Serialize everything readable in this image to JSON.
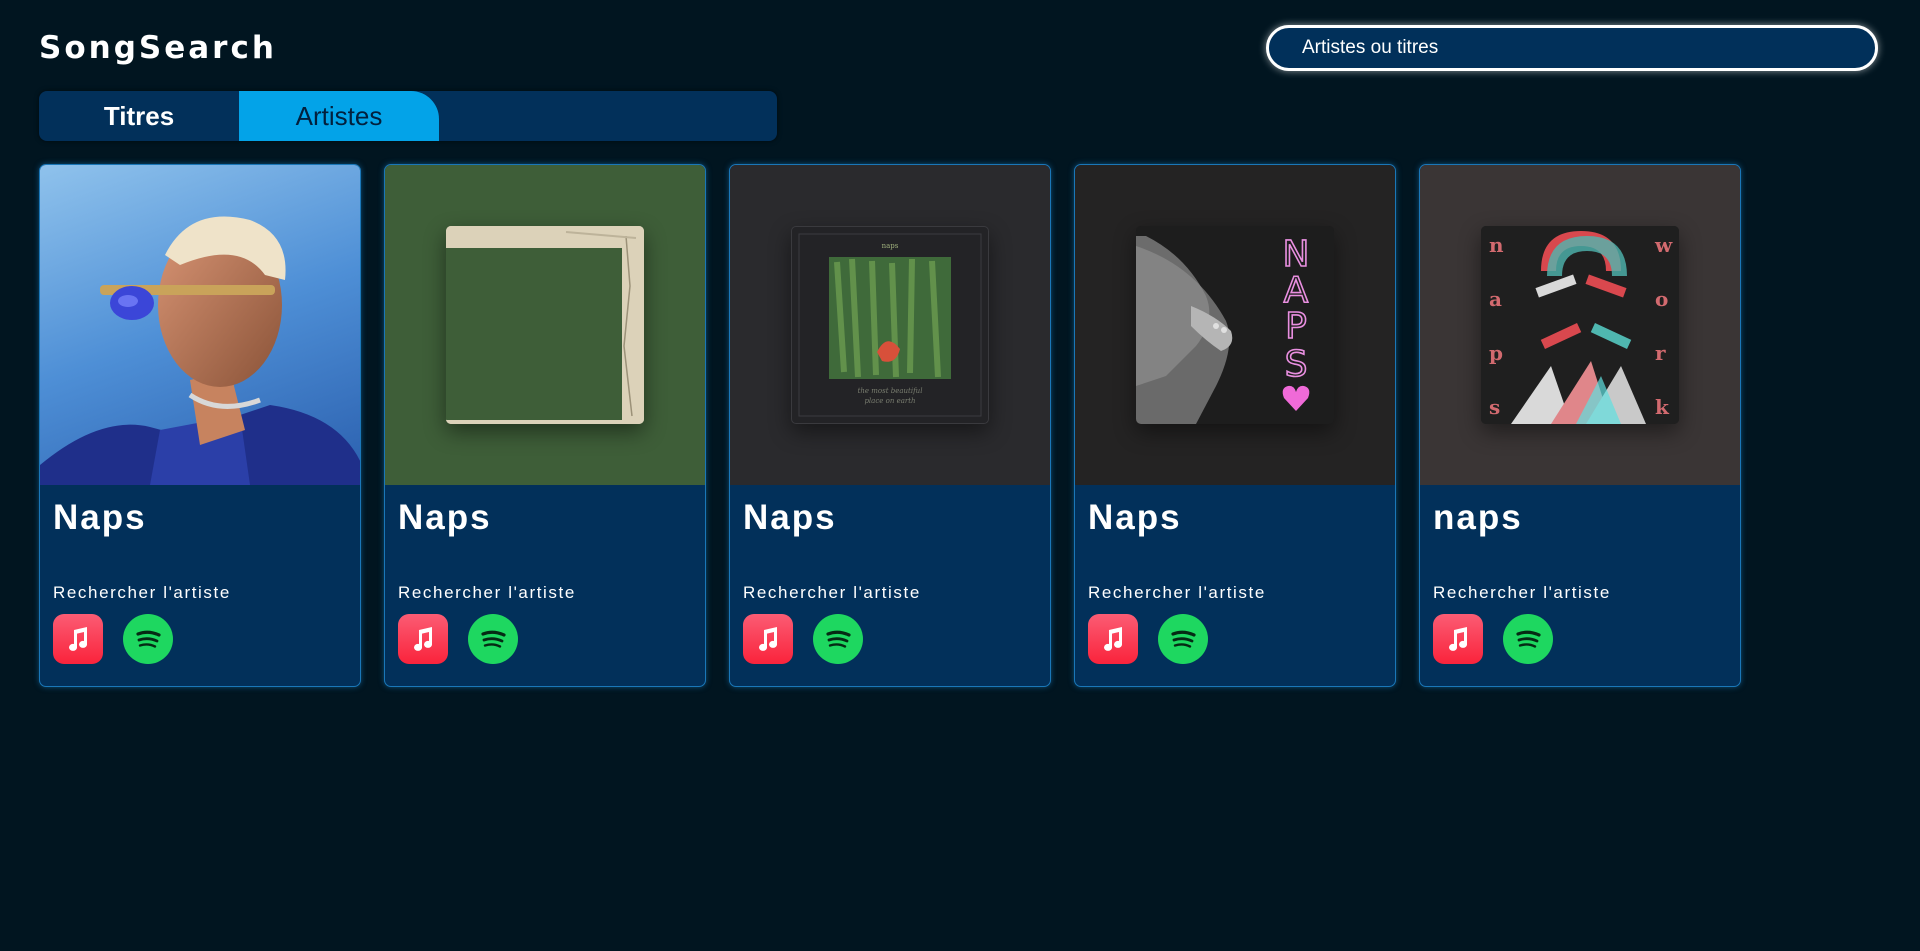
{
  "app": {
    "logo": "SongSearch"
  },
  "search": {
    "placeholder": "Artistes ou titres"
  },
  "tabs": [
    {
      "label": "Titres",
      "active": false
    },
    {
      "label": "Artistes",
      "active": true
    }
  ],
  "cards": [
    {
      "name": "Naps",
      "link": "Rechercher l'artiste"
    },
    {
      "name": "Naps",
      "link": "Rechercher l'artiste"
    },
    {
      "name": "Naps",
      "link": "Rechercher l'artiste"
    },
    {
      "name": "Naps",
      "link": "Rechercher l'artiste"
    },
    {
      "name": "naps",
      "link": "Rechercher l'artiste"
    }
  ],
  "artwork_text": {
    "album3_title": "naps",
    "album3_subtitle_1": "the most beautiful",
    "album3_subtitle_2": "place on earth",
    "album4_title": "NAPS",
    "album5_left": [
      "n",
      "a",
      "p",
      "s"
    ],
    "album5_right": [
      "w",
      "o",
      "r",
      "k"
    ]
  },
  "icons": {
    "apple_music": "apple-music-icon",
    "spotify": "spotify-icon"
  },
  "colors": {
    "background": "#011520",
    "panel": "#02305a",
    "accent": "#03a3e8",
    "apple": "#fa233b",
    "spotify": "#1ed760"
  }
}
